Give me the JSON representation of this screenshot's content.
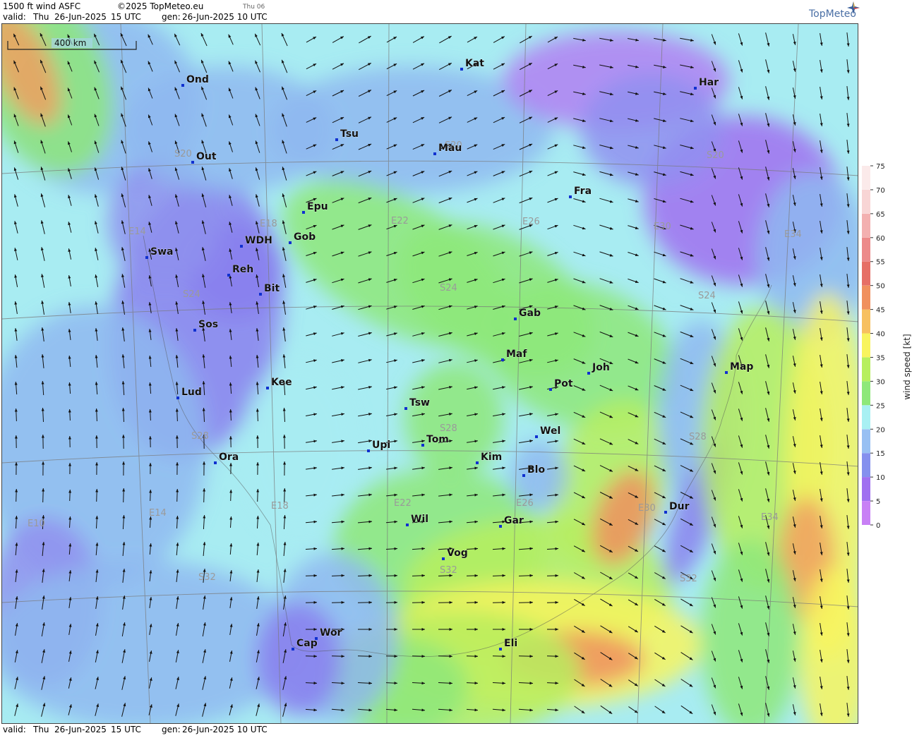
{
  "header": {
    "title": "1500 ft wind ASFC",
    "copyright": "©2025 TopMeteo.eu",
    "day_tag": "Thu 06",
    "valid_label": "valid:",
    "valid_day": "Thu",
    "valid_date": "26-Jun-2025",
    "valid_time": "15 UTC",
    "gen_label": "gen:",
    "gen_value": "26-Jun-2025 10 UTC"
  },
  "footer": {
    "valid_label": "valid:",
    "valid_day": "Thu",
    "valid_date": "26-Jun-2025",
    "valid_time": "15 UTC",
    "gen_label": "gen:",
    "gen_value": "26-Jun-2025 10 UTC"
  },
  "logo": {
    "text": "TopMeteo"
  },
  "scale_bar": {
    "label": "400 km"
  },
  "legend": {
    "title": "wind speed [kt]",
    "ticks": [
      "0",
      "5",
      "10",
      "15",
      "20",
      "25",
      "30",
      "35",
      "40",
      "45",
      "50",
      "55",
      "60",
      "65",
      "70",
      "75"
    ],
    "colors": [
      "#c880f5",
      "#a070f0",
      "#8590ee",
      "#98c0f3",
      "#a8f0f3",
      "#8ee87a",
      "#b7ef5e",
      "#f8f45e",
      "#f7c060",
      "#f0905e",
      "#e66f66",
      "#ec8a8a",
      "#f3b0b0",
      "#f8d5d5",
      "#fbeaea",
      "#ffffff"
    ]
  },
  "cities": [
    {
      "name": "Kat"
    },
    {
      "name": "Ond"
    },
    {
      "name": "Har"
    },
    {
      "name": "Tsu"
    },
    {
      "name": "Mau"
    },
    {
      "name": "Out"
    },
    {
      "name": "Fra"
    },
    {
      "name": "Epu"
    },
    {
      "name": "Gob"
    },
    {
      "name": "WDH"
    },
    {
      "name": "Swa"
    },
    {
      "name": "Reh"
    },
    {
      "name": "Bit"
    },
    {
      "name": "Gab"
    },
    {
      "name": "Sos"
    },
    {
      "name": "Maf"
    },
    {
      "name": "Joh"
    },
    {
      "name": "Map"
    },
    {
      "name": "Pot"
    },
    {
      "name": "Kee"
    },
    {
      "name": "Lud"
    },
    {
      "name": "Tsw"
    },
    {
      "name": "Wel"
    },
    {
      "name": "Tom"
    },
    {
      "name": "Upi"
    },
    {
      "name": "Kim"
    },
    {
      "name": "Ora"
    },
    {
      "name": "Blo"
    },
    {
      "name": "Dur"
    },
    {
      "name": "Wil"
    },
    {
      "name": "Gar"
    },
    {
      "name": "Vog"
    },
    {
      "name": "Wor"
    },
    {
      "name": "Cap"
    },
    {
      "name": "Eli"
    }
  ],
  "grid_labels": [
    "S20",
    "S20",
    "S20",
    "E14",
    "E18",
    "E22",
    "E26",
    "E30",
    "E34",
    "S24",
    "S24",
    "S24",
    "S28",
    "S28",
    "S28",
    "E10",
    "E14",
    "E18",
    "E22",
    "E26",
    "E30",
    "E34",
    "S32",
    "S32",
    "S32"
  ]
}
